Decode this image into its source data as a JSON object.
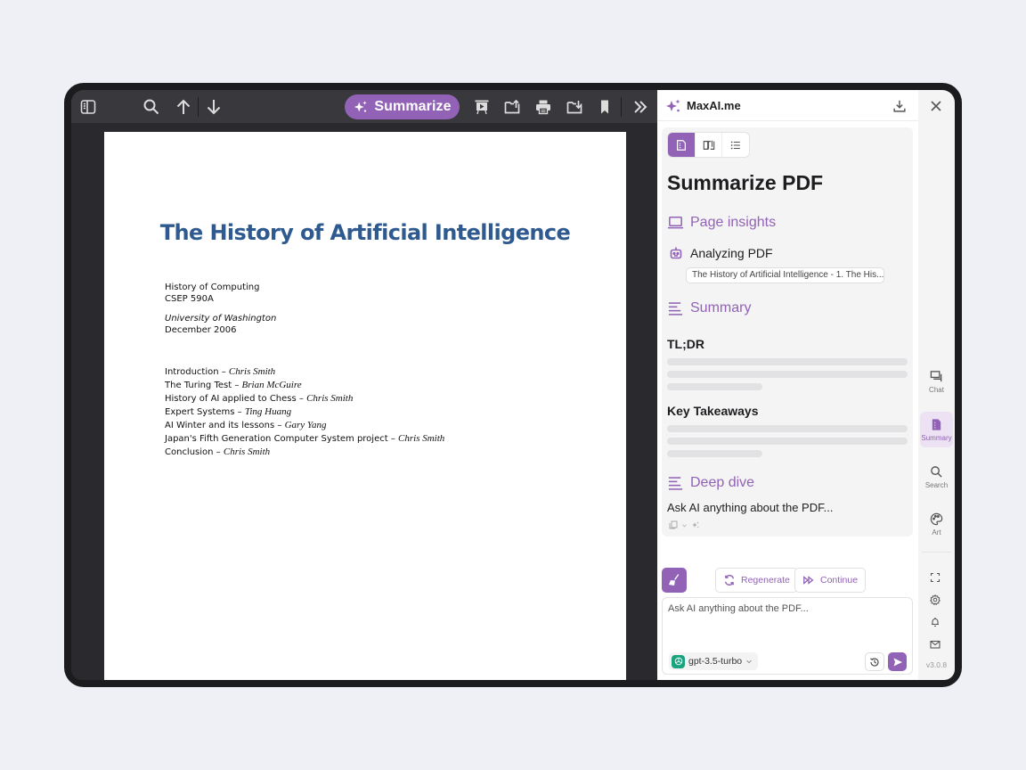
{
  "toolbar": {
    "summarize_label": "Summarize",
    "icons": [
      "sidebar-toggle-icon",
      "search-icon",
      "arrow-up-icon",
      "arrow-down-icon",
      "presentation-icon",
      "open-file-icon",
      "print-icon",
      "save-download-icon",
      "bookmark-icon",
      "more-tools-icon"
    ]
  },
  "document": {
    "title": "The History of Artificial Intelligence",
    "course": "History of Computing",
    "course_code": "CSEP 590A",
    "university": "University of Washington",
    "date": "December 2006",
    "toc": [
      {
        "topic": "Introduction – ",
        "author": "Chris Smith"
      },
      {
        "topic": "The Turing Test – ",
        "author": "Brian McGuire"
      },
      {
        "topic": "History of AI applied to Chess – ",
        "author": "Chris Smith"
      },
      {
        "topic": "Expert Systems – ",
        "author": "Ting Huang"
      },
      {
        "topic": "AI Winter and its lessons – ",
        "author": "Gary Yang"
      },
      {
        "topic": "Japan's Fifth Generation Computer System project – ",
        "author": "Chris Smith"
      },
      {
        "topic": "Conclusion – ",
        "author": "Chris Smith"
      }
    ]
  },
  "panel": {
    "brand": "MaxAI.me",
    "heading": "Summarize PDF",
    "sections": {
      "page_insights": "Page insights",
      "analyzing": "Analyzing PDF",
      "source_chip": "The History of Artificial Intelligence - 1. The His...",
      "summary": "Summary",
      "tldr": "TL;DR",
      "key_takeaways": "Key Takeaways",
      "deep_dive": "Deep dive",
      "deep_dive_text": "Ask AI anything about the PDF..."
    },
    "actions": {
      "regenerate": "Regenerate",
      "continue": "Continue"
    },
    "input": {
      "placeholder": "Ask AI anything about the PDF...",
      "model": "gpt-3.5-turbo"
    }
  },
  "rail": {
    "items": [
      {
        "label": "Chat"
      },
      {
        "label": "Summary",
        "active": true
      },
      {
        "label": "Search"
      },
      {
        "label": "Art"
      }
    ],
    "version": "v3.0.8"
  },
  "colors": {
    "accent": "#9162b5",
    "doc_title": "#2f5a8f",
    "toolbar_bg": "#38383d"
  }
}
